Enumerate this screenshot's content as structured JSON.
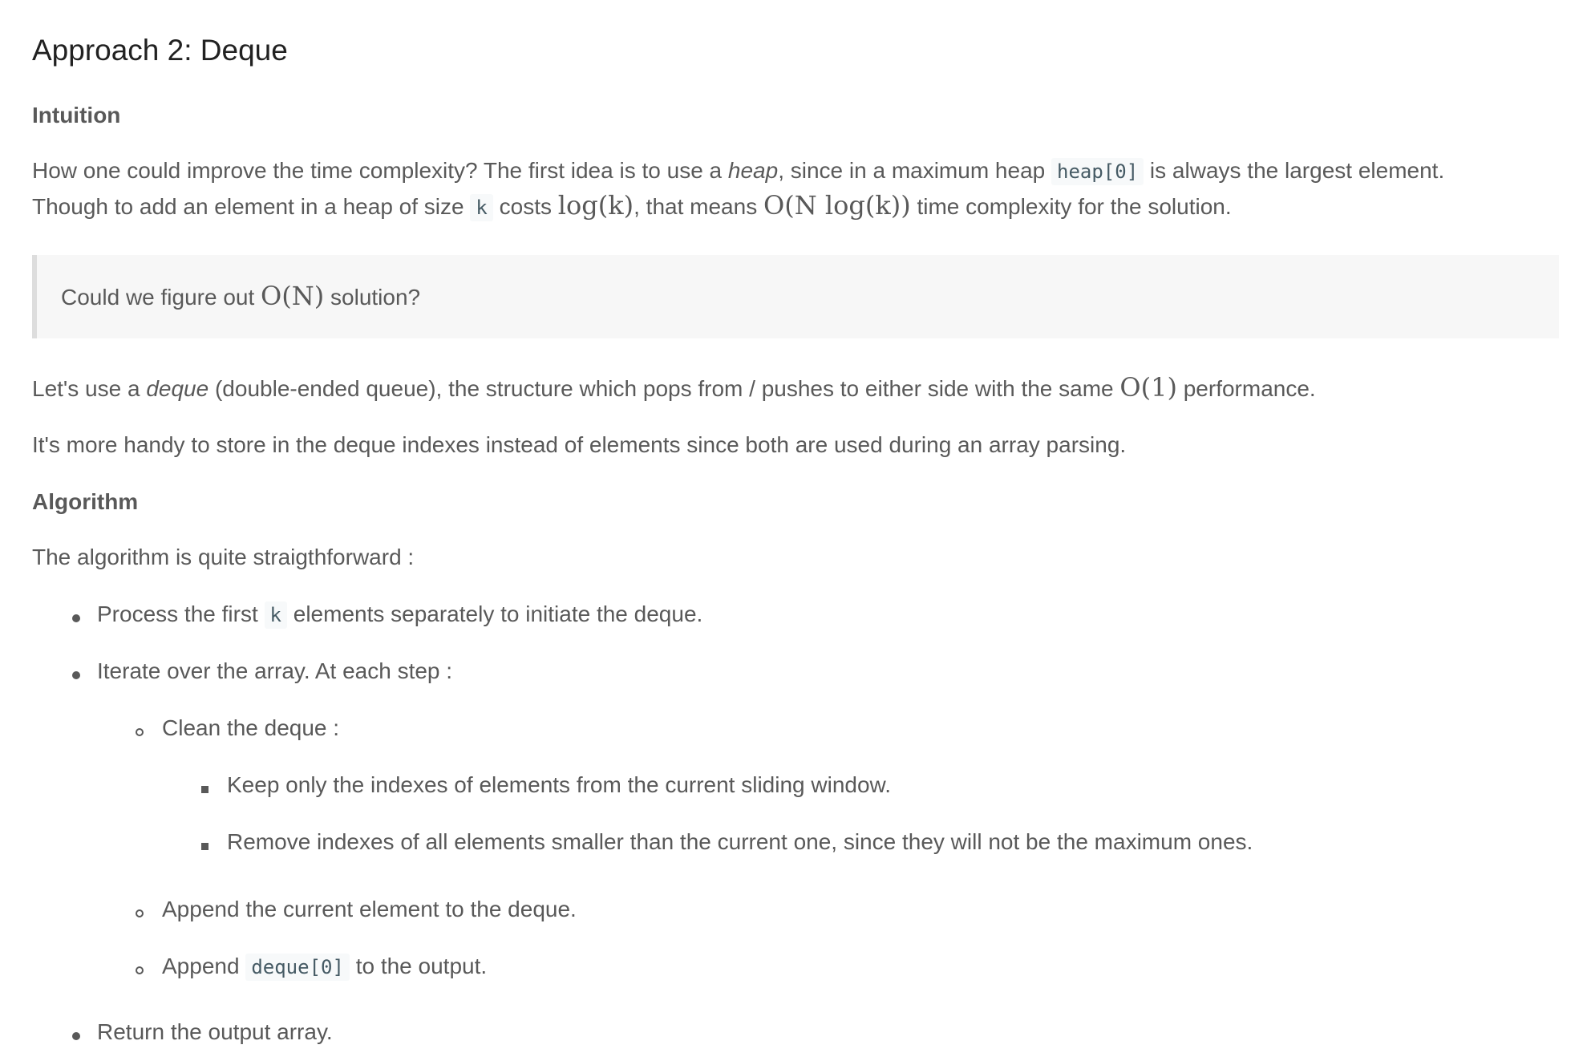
{
  "section_title": "Approach 2: Deque",
  "intuition": {
    "heading": "Intuition",
    "p1": {
      "t1": "How one could improve the time complexity? The first idea is to use a ",
      "heap_em": "heap",
      "t2": ", since in a maximum heap ",
      "code_heap0": "heap[0]",
      "t3": " is always the largest element."
    },
    "p2": {
      "t1": "Though to add an element in a heap of size ",
      "code_k": "k",
      "t2": " costs ",
      "math_logk": "log(k)",
      "t3": ", that means ",
      "math_nlogk": "O(N log(k))",
      "t4": " time complexity for the solution."
    }
  },
  "callout": {
    "t1": "Could we figure out ",
    "math": "O(N)",
    "t2": " solution?"
  },
  "deque_para": {
    "t1": "Let's use a ",
    "em": "deque",
    "t2": " (double-ended queue), the structure which pops from / pushes to either side with the same ",
    "math": "O(1)",
    "t3": " performance."
  },
  "indexes_para": "It's more handy to store in the deque indexes instead of elements since both are used during an array parsing.",
  "algorithm": {
    "heading": "Algorithm",
    "intro": "The algorithm is quite straigthforward :",
    "item1": {
      "t1": "Process the first ",
      "code_k": "k",
      "t2": " elements separately to initiate the deque."
    },
    "item2": "Iterate over the array. At each step :",
    "sub1": "Clean the deque :",
    "subsub1": "Keep only the indexes of elements from the current sliding window.",
    "subsub2": "Remove indexes of all elements smaller than the current one, since they will not be the maximum ones.",
    "sub2": "Append the current element to the deque.",
    "sub3": {
      "t1": "Append ",
      "code": "deque[0]",
      "t2": " to the output."
    },
    "item3": "Return the output array."
  }
}
